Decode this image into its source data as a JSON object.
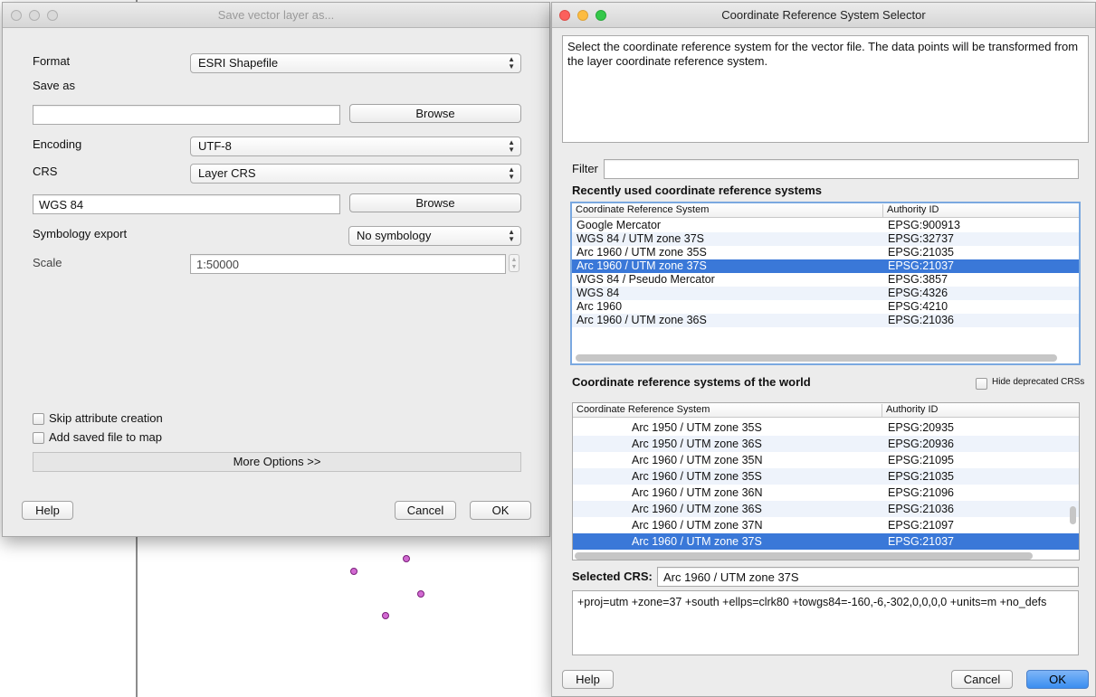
{
  "save_dialog": {
    "title": "Save vector layer as...",
    "format_label": "Format",
    "format_value": "ESRI Shapefile",
    "save_as_label": "Save as",
    "save_as_value": "",
    "browse_label": "Browse",
    "encoding_label": "Encoding",
    "encoding_value": "UTF-8",
    "crs_label": "CRS",
    "crs_value": "Layer CRS",
    "crs_field_value": "WGS 84",
    "browse_crs_label": "Browse",
    "symbology_label": "Symbology export",
    "symbology_value": "No symbology",
    "scale_label": "Scale",
    "scale_value": "1:50000",
    "skip_attr_label": "Skip attribute creation",
    "add_saved_label": "Add saved file to map",
    "more_options_label": "More Options >>",
    "help_label": "Help",
    "cancel_label": "Cancel",
    "ok_label": "OK"
  },
  "crs_dialog": {
    "title": "Coordinate Reference System Selector",
    "description": "Select the coordinate reference system for the vector file. The data points will be transformed from the layer coordinate reference system.",
    "filter_label": "Filter",
    "filter_value": "",
    "recent_heading": "Recently used coordinate reference systems",
    "col_crs": "Coordinate Reference System",
    "col_auth": "Authority ID",
    "recent_rows": [
      {
        "name": "Google Mercator",
        "id": "EPSG:900913"
      },
      {
        "name": "WGS 84 / UTM zone 37S",
        "id": "EPSG:32737"
      },
      {
        "name": "Arc 1960 / UTM zone 35S",
        "id": "EPSG:21035"
      },
      {
        "name": "Arc 1960 / UTM zone 37S",
        "id": "EPSG:21037"
      },
      {
        "name": "WGS 84 / Pseudo Mercator",
        "id": "EPSG:3857"
      },
      {
        "name": "WGS 84",
        "id": "EPSG:4326"
      },
      {
        "name": "Arc 1960",
        "id": "EPSG:4210"
      },
      {
        "name": "Arc 1960 / UTM zone 36S",
        "id": "EPSG:21036"
      }
    ],
    "world_heading": "Coordinate reference systems of the world",
    "hide_deprecated_label": "Hide deprecated CRSs",
    "world_rows": [
      {
        "name": "Arc 1950 / UTM zone 35S",
        "id": "EPSG:20935"
      },
      {
        "name": "Arc 1950 / UTM zone 36S",
        "id": "EPSG:20936"
      },
      {
        "name": "Arc 1960 / UTM zone 35N",
        "id": "EPSG:21095"
      },
      {
        "name": "Arc 1960 / UTM zone 35S",
        "id": "EPSG:21035"
      },
      {
        "name": "Arc 1960 / UTM zone 36N",
        "id": "EPSG:21096"
      },
      {
        "name": "Arc 1960 / UTM zone 36S",
        "id": "EPSG:21036"
      },
      {
        "name": "Arc 1960 / UTM zone 37N",
        "id": "EPSG:21097"
      },
      {
        "name": "Arc 1960 / UTM zone 37S",
        "id": "EPSG:21037"
      }
    ],
    "selected_crs_label": "Selected CRS:",
    "selected_crs_value": "Arc 1960 / UTM zone 37S",
    "proj_string": "+proj=utm +zone=37 +south +ellps=clrk80 +towgs84=-160,-6,-302,0,0,0,0 +units=m +no_defs",
    "help_label": "Help",
    "cancel_label": "Cancel",
    "ok_label": "OK"
  },
  "colors": {
    "selection": "#3a78d8",
    "ok_button": "#3a8ef0",
    "map_point": "#d26ad2"
  }
}
